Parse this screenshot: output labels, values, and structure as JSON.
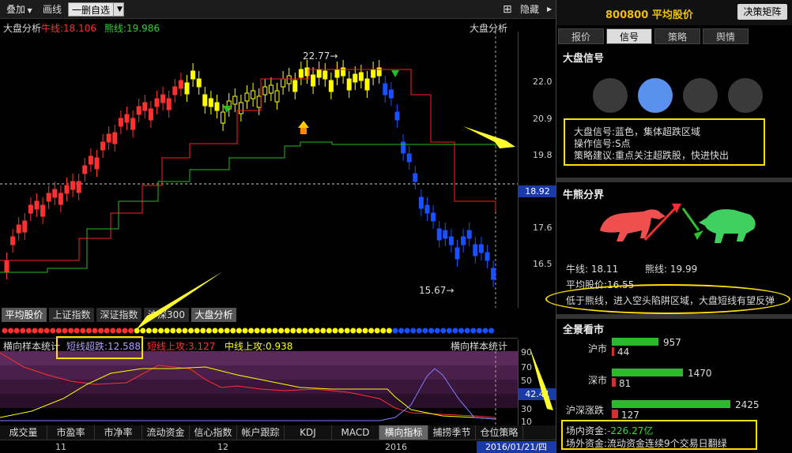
{
  "toolbar": {
    "overlay": "叠加",
    "draw": "画线",
    "watchlist": "一删自选",
    "hide": "隐藏"
  },
  "chart": {
    "title_left": "大盘分析",
    "title_right": "大盘分析",
    "bull_line": "牛线:18.106",
    "bear_line": "熊线:19.986",
    "high_label": "22.77→",
    "low_label": "15.67→",
    "price_tag": "18.92",
    "ticks": [
      "22.0",
      "20.9",
      "19.8",
      "17.6",
      "16.5"
    ],
    "colors": {
      "up": "#ff3030",
      "neutral": "#ffff00",
      "down": "#1a50ff",
      "bull": "#ff2020",
      "bear": "#20c020"
    }
  },
  "panel_tabs": [
    "平均股价",
    "上证指数",
    "深证指数",
    "沪深300",
    "大盘分析"
  ],
  "indicator": {
    "name": "横向样本统计",
    "v1": "短线超跌:12.588",
    "v2": "短线上攻:3.127",
    "v3": "中线上攻:0.938",
    "right_name": "横向样本统计",
    "ticks": [
      "90",
      "70",
      "50",
      "30",
      "10"
    ],
    "value_tag": "42.41"
  },
  "bottom_tabs": [
    "成交量",
    "市盈率",
    "市净率",
    "流动资金",
    "信心指数",
    "帐户跟踪",
    "KDJ",
    "MACD",
    "横向指标",
    "捕捞季节",
    "仓位策略"
  ],
  "dates": [
    "11",
    "12",
    "2016",
    "2016/01/21/四"
  ],
  "right": {
    "code": "800800",
    "name": "平均股价",
    "decision_btn": "决策矩阵",
    "tabs": [
      "报价",
      "信号",
      "策略",
      "舆情"
    ],
    "signal_title": "大盘信号",
    "signal_lines": [
      "大盘信号:蓝色，集体超跌区域",
      "操作信号:S点",
      "策略建议:重点关注超跌股，快进快出"
    ],
    "bull_bear_title": "牛熊分界",
    "bull": "牛线: 18.11",
    "bear": "熊线: 19.99",
    "avg": "平均股价:16.55",
    "comment": "低于熊线，进入空头陷阱区域，大盘短线有望反弹",
    "overview_title": "全景看市",
    "markets": [
      {
        "name": "沪市",
        "up": "957",
        "down": "44",
        "up_frac": 0.39,
        "down_frac": 0.02
      },
      {
        "name": "深市",
        "up": "1470",
        "down": "81",
        "up_frac": 0.6,
        "down_frac": 0.03
      },
      {
        "name": "沪深涨跌",
        "up": "2425",
        "down": "127",
        "up_frac": 1.0,
        "down_frac": 0.05
      }
    ],
    "fund_in_label": "场内资金:",
    "fund_in": "-226.27亿",
    "fund_out": "场外资金:流动资金连续9个交易日翻绿"
  }
}
